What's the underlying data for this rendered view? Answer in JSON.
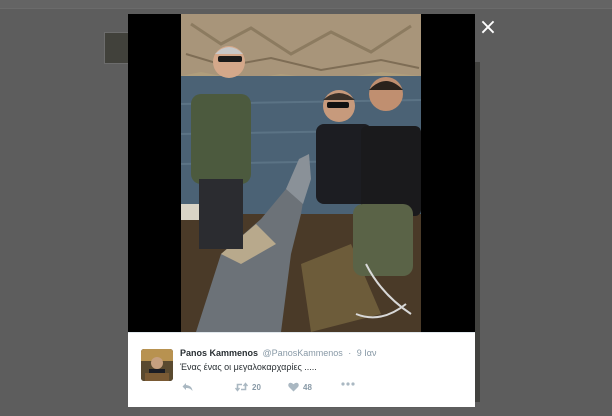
{
  "modal": {
    "close_label": "×"
  },
  "tweet": {
    "name": "Panos Kammenos",
    "handle": "@PanosKammenos",
    "separator": "·",
    "time": "9 Ιαν",
    "text": "Ένας ένας οι μεγαλοκαρχαρίες .....",
    "retweet_count": "20",
    "like_count": "48"
  },
  "icons": {
    "close": "close-icon",
    "reply": "reply-icon",
    "retweet": "retweet-icon",
    "like": "heart-icon",
    "more": "more-dots-icon"
  },
  "colors": {
    "overlay": "#5d5d5d",
    "modal_bg": "#000000",
    "panel_bg": "#ffffff",
    "icon_gray": "#aab8c2",
    "text_dark": "#292f33",
    "text_muted": "#8899a6"
  }
}
